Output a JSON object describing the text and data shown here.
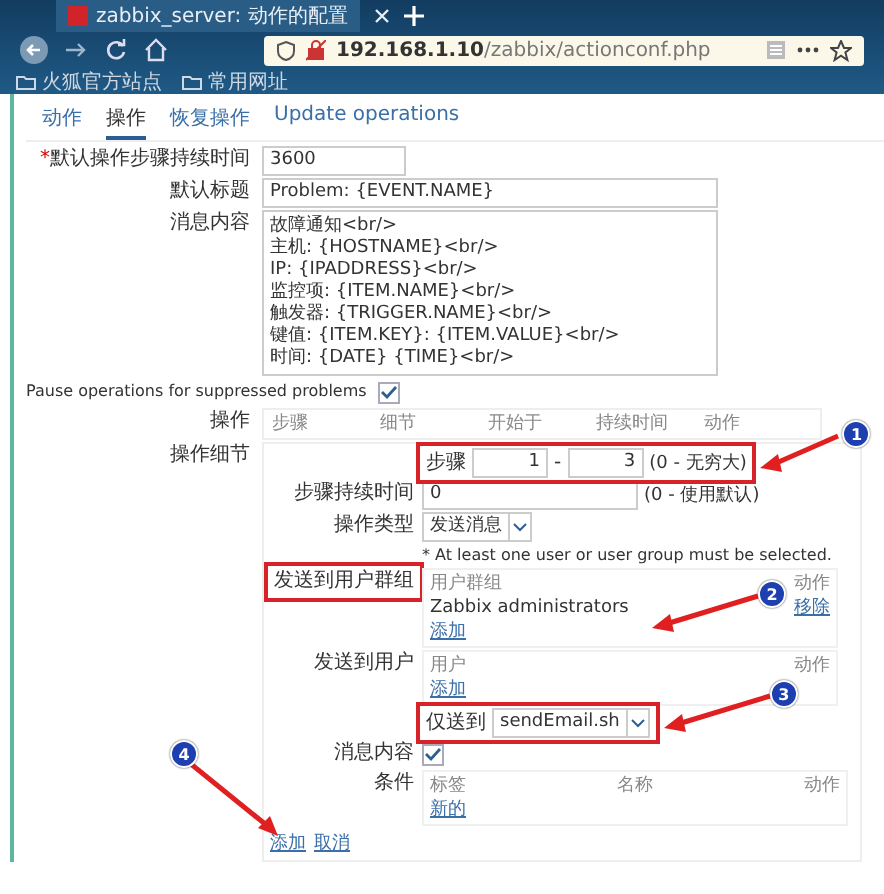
{
  "browser": {
    "tab_title": "zabbix_server: 动作的配置",
    "address": {
      "host": "192.168.1.10",
      "path": "/zabbix/actionconf.php"
    },
    "bookmarks": [
      "火狐官方站点",
      "常用网址"
    ]
  },
  "tabs": [
    {
      "label": "动作",
      "selected": false
    },
    {
      "label": "操作",
      "selected": true
    },
    {
      "label": "恢复操作",
      "selected": false
    },
    {
      "label": "Update operations",
      "selected": false
    }
  ],
  "fields": [
    {
      "label": "默认操作步骤持续时间",
      "required_mark": "*",
      "kind": "short",
      "value": "3600"
    },
    {
      "label": "默认标题",
      "kind": "long",
      "value": "Problem: {EVENT.NAME}"
    },
    {
      "label": "消息内容",
      "kind": "multiline",
      "lines": [
        "故障通知<br/>",
        "主机: {HOSTNAME}<br/>",
        "IP: {IPADDRESS}<br/>",
        "监控项: {ITEM.NAME}<br/>",
        "触发器: {TRIGGER.NAME}<br/>",
        "键值: {ITEM.KEY}: {ITEM.VALUE}<br/>",
        "时间: {DATE} {TIME}<br/>"
      ]
    }
  ],
  "pause_suppressed": {
    "label": "Pause operations for suppressed problems",
    "checked": true
  },
  "operations": {
    "label": "操作",
    "columns": [
      "步骤",
      "细节",
      "开始于",
      "持续时间",
      "动作"
    ]
  },
  "operation_details": {
    "label": "操作细节",
    "steps": {
      "label": "步骤",
      "from": "1",
      "separator": "-",
      "to": "3",
      "hint": "(0 - 无穷大)",
      "annotation": "1"
    },
    "step_duration": {
      "label": "步骤持续时间",
      "value": "0",
      "hint": "(0 - 使用默认)"
    },
    "operation_type": {
      "label": "操作类型",
      "value": "发送消息"
    },
    "note": "* At least one user or user group must be selected.",
    "user_groups": {
      "label": "发送到用户群组",
      "columns": [
        "用户群组",
        "动作"
      ],
      "rows": [
        {
          "name": "Zabbix administrators",
          "action": "移除"
        }
      ],
      "add": "添加",
      "annotation": "2"
    },
    "users": {
      "label": "发送到用户",
      "columns": [
        "用户",
        "动作"
      ],
      "add": "添加"
    },
    "send_only_to": {
      "label": "仅送到",
      "value": "sendEmail.sh",
      "annotation": "3"
    },
    "message_content": {
      "label": "消息内容",
      "checked": true
    },
    "conditions": {
      "label": "条件",
      "columns": [
        "标签",
        "名称",
        "动作"
      ],
      "add": "新的"
    },
    "links": [
      "添加",
      "取消"
    ],
    "annotation": "4"
  }
}
